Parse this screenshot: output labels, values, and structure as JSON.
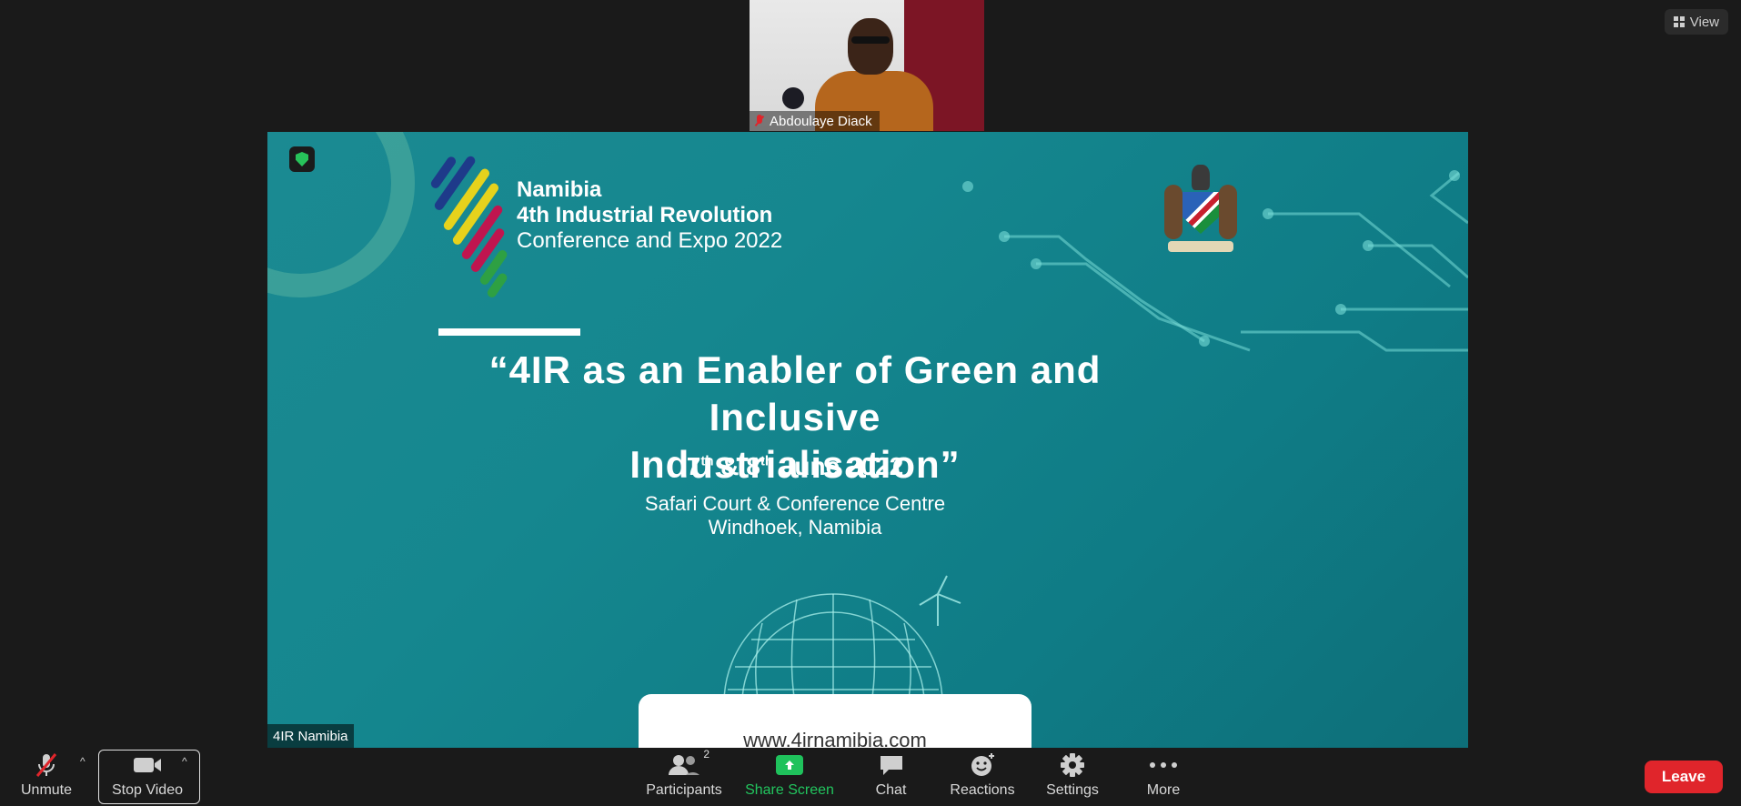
{
  "view_button": {
    "label": "View",
    "icon": "grid-icon"
  },
  "participant": {
    "name": "Abdoulaye Diack",
    "mic_icon": "mic-muted-icon"
  },
  "shared_screen": {
    "owner_label": "4IR Namibia",
    "security_icon": "shield-check-icon",
    "slide": {
      "logo_line1": "Namibia",
      "logo_line2": "4th Industrial Revolution",
      "logo_line3": "Conference and Expo 2022",
      "headline_line1": "“4IR as an Enabler of Green and Inclusive",
      "headline_line2": "Industrialisation”",
      "date_day1": "7",
      "date_sup1": "th",
      "date_amp": " & ",
      "date_day2": "8",
      "date_sup2": "th",
      "date_rest": " June 2022",
      "venue_line1": "Safari Court & Conference Centre",
      "venue_line2": "Windhoek, Namibia",
      "url": "www.4irnamibia.com"
    }
  },
  "toolbar": {
    "unmute": "Unmute",
    "stop_video": "Stop Video",
    "participants": "Participants",
    "participants_count": "2",
    "share_screen": "Share Screen",
    "chat": "Chat",
    "reactions": "Reactions",
    "settings": "Settings",
    "more": "More",
    "leave": "Leave",
    "caret": "^"
  },
  "colors": {
    "leave": "#e0252b",
    "share_screen": "#22c55e",
    "slide_bg": "#15878f"
  }
}
